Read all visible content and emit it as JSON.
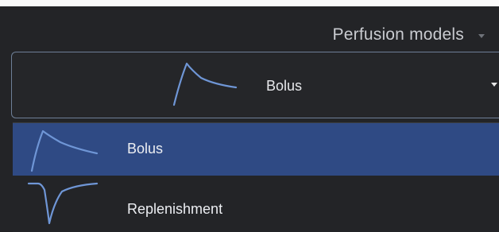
{
  "header": {
    "title": "Perfusion models",
    "dropdown_icon": "caret-down-icon"
  },
  "selector": {
    "selected_label": "Bolus",
    "selected_icon": "bolus-curve-icon",
    "dropdown_icon": "caret-down-icon"
  },
  "options": [
    {
      "label": "Bolus",
      "icon": "bolus-curve-icon",
      "selected": true
    },
    {
      "label": "Replenishment",
      "icon": "replenishment-curve-icon",
      "selected": false
    }
  ],
  "colors": {
    "background": "#232427",
    "selected_row": "#2f4a84",
    "combo_border": "#6e7f97",
    "curve": "#6f96d6",
    "text": "#eceef2"
  }
}
